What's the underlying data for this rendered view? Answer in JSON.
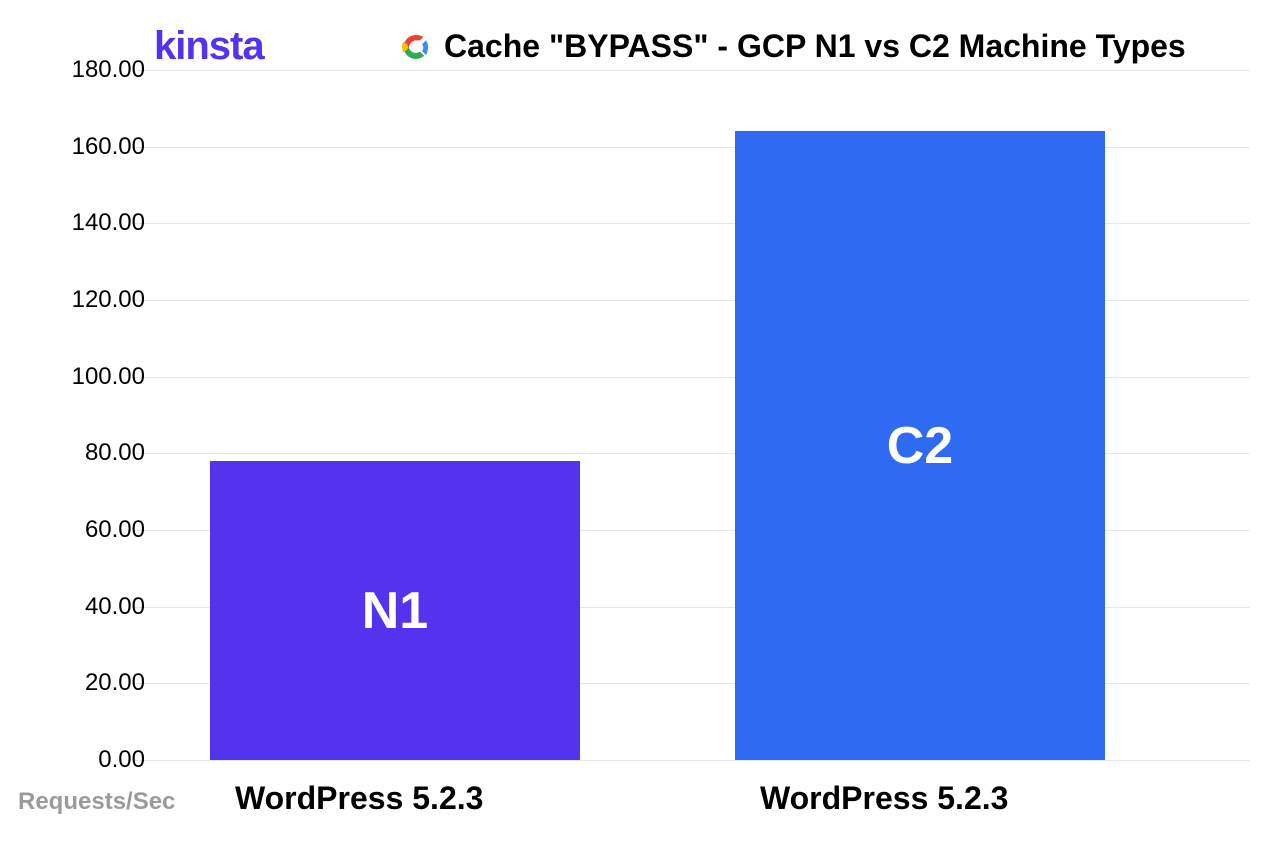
{
  "brand": {
    "logo_text": "kinsta"
  },
  "header": {
    "title": "Cache \"BYPASS\" - GCP N1 vs C2 Machine Types"
  },
  "chart_data": {
    "type": "bar",
    "title": "Cache \"BYPASS\" - GCP N1 vs C2 Machine Types",
    "categories": [
      "WordPress 5.2.3",
      "WordPress 5.2.3"
    ],
    "series": [
      {
        "name": "N1",
        "value": 78,
        "color": "#5333ed"
      },
      {
        "name": "C2",
        "value": 164,
        "color": "#2f6bf2"
      }
    ],
    "ylabel": "Requests/Sec",
    "xlabel": "",
    "ylim": [
      0,
      180
    ],
    "yticks": [
      "0.00",
      "20.00",
      "40.00",
      "60.00",
      "80.00",
      "100.00",
      "120.00",
      "140.00",
      "160.00",
      "180.00"
    ],
    "grid": true
  }
}
